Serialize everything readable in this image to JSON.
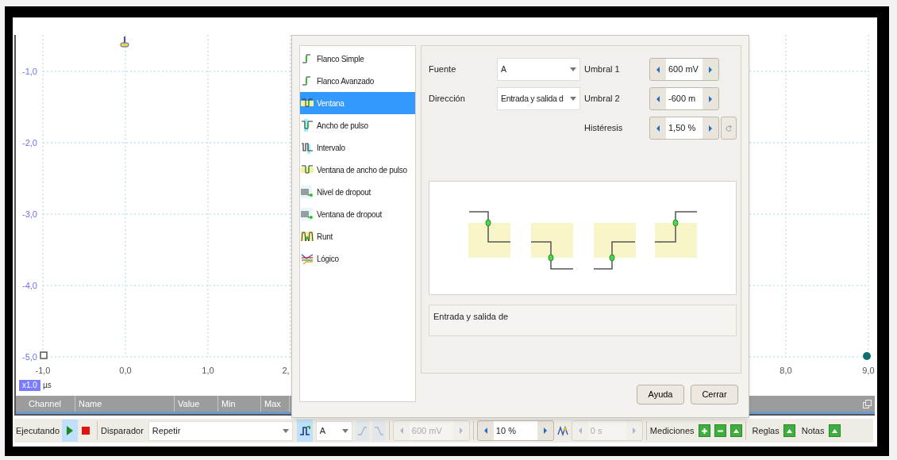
{
  "plot": {
    "y_labels": [
      "-1,0",
      "-2,0",
      "-3,0",
      "-4,0",
      "-5,0"
    ],
    "x_labels": [
      "-1,0",
      "0,0",
      "1,0",
      "2,",
      "8,0",
      "9,0"
    ],
    "zoom": "x1.0",
    "unit": "µs"
  },
  "table": {
    "columns": [
      "Channel",
      "Name",
      "Value",
      "Min",
      "Max"
    ]
  },
  "dialog": {
    "trigger_types": [
      {
        "label": "Flanco Simple",
        "kind": "edge",
        "selected": false
      },
      {
        "label": "Flanco Avanzado",
        "kind": "edge",
        "selected": false
      },
      {
        "label": "Ventana",
        "kind": "window",
        "selected": true
      },
      {
        "label": "Ancho de pulso",
        "kind": "pulse",
        "selected": false
      },
      {
        "label": "Intervalo",
        "kind": "interval",
        "selected": false
      },
      {
        "label": "Ventana de ancho de pulso",
        "kind": "window",
        "selected": false
      },
      {
        "label": "Nivel de dropout",
        "kind": "dropout",
        "selected": false
      },
      {
        "label": "Ventana de dropout",
        "kind": "dropout",
        "selected": false
      },
      {
        "label": "Runt",
        "kind": "runt",
        "selected": false
      },
      {
        "label": "Lógico",
        "kind": "logic",
        "selected": false
      }
    ],
    "source_label": "Fuente",
    "source": "A",
    "direction_label": "Dirección",
    "direction": "Entrada y salida d",
    "threshold1_label": "Umbral 1",
    "threshold1": "600 mV",
    "threshold2_label": "Umbral 2",
    "threshold2": "-600 m",
    "hysteresis_label": "Histéresis",
    "hysteresis": "1,50 %",
    "description": "Entrada y salida de",
    "buttons": [
      "Ayuda",
      "Cerrar"
    ]
  },
  "toolbar": {
    "run_label": "Ejecutando",
    "running": true,
    "trigger_label": "Disparador",
    "trigger_mode": "Repetir",
    "channel": "A",
    "edge_buttons": {
      "disabled": true
    },
    "threshold": {
      "value": "600 mV",
      "disabled": true
    },
    "pretrigger": {
      "value": "10 %",
      "disabled": false
    },
    "delay": {
      "value": "0 s",
      "disabled": true
    },
    "measurements_label": "Mediciones",
    "rulers_label": "Reglas",
    "notes_label": "Notas"
  }
}
